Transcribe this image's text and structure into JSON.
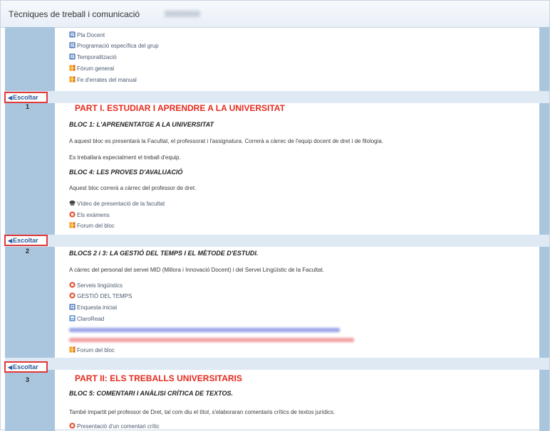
{
  "header": {
    "course_title": "Tècniques de treball i comunicació"
  },
  "top_resources": [
    {
      "label": "Pla Docent",
      "icon": "page-icon"
    },
    {
      "label": "Programació específica del grup",
      "icon": "page-icon"
    },
    {
      "label": "Temporalització",
      "icon": "page-icon"
    },
    {
      "label": "Fòrum general",
      "icon": "forum-icon"
    },
    {
      "label": "Fe d'errates del manual",
      "icon": "forum-icon"
    }
  ],
  "listen_label": "Escoltar",
  "sections": [
    {
      "number": "1",
      "part_title": "PART I. ESTUDIAR I APRENDRE A LA UNIVERSITAT",
      "bloc1_title": "BLOC 1: L'APRENENTATGE A LA UNIVERSITAT",
      "bloc1_text1": "A aquest bloc es presentarà la Facultat, el professorat i l'assignatura. Correrà a càrrec de l'equip docent de dret i de filologia.",
      "bloc1_text2": "Es treballarà especialment el treball d'equip.",
      "bloc4_title": "BLOC 4: LES PROVES D'AVALUACIÓ",
      "bloc4_text": "Aquest bloc correrà a càrrec del professor de dret.",
      "resources": [
        {
          "label": "Vídeo de presentació de la facultat",
          "icon": "video-icon"
        },
        {
          "label": "Els exàmens",
          "icon": "resource-icon"
        },
        {
          "label": "Forum del bloc",
          "icon": "forum-icon"
        }
      ]
    },
    {
      "number": "2",
      "bloc_title": "BLOCS 2 i 3: LA GESTIÓ DEL TEMPS I EL MÈTODE D'ESTUDI.",
      "text": "A càrrec del personal del servei MID (Millora i Innovació Docent) i del Servei Lingüístic de la Facultat.",
      "resources": [
        {
          "label": "Serveis lingüístics",
          "icon": "resource-icon"
        },
        {
          "label": "GESTIÓ DEL TEMPS",
          "icon": "resource-icon"
        },
        {
          "label": "Enquesta inicial",
          "icon": "page-icon"
        },
        {
          "label": "ClaroRead",
          "icon": "link-icon"
        }
      ],
      "forum_label": "Forum del bloc"
    },
    {
      "number": "3",
      "part_title": "PART II: ELS TREBALLS UNIVERSITARIS",
      "bloc_title": "BLOC 5: COMENTARI I ANÀLISI CRÍTICA DE TEXTOS.",
      "text": "També impartit pel professor de Dret, tal com diu el títol, s'elaboraran comentaris crítics de textos jurídics.",
      "resources": [
        {
          "label": "Presentació d'un comentari crític",
          "icon": "resource-icon"
        }
      ]
    }
  ]
}
